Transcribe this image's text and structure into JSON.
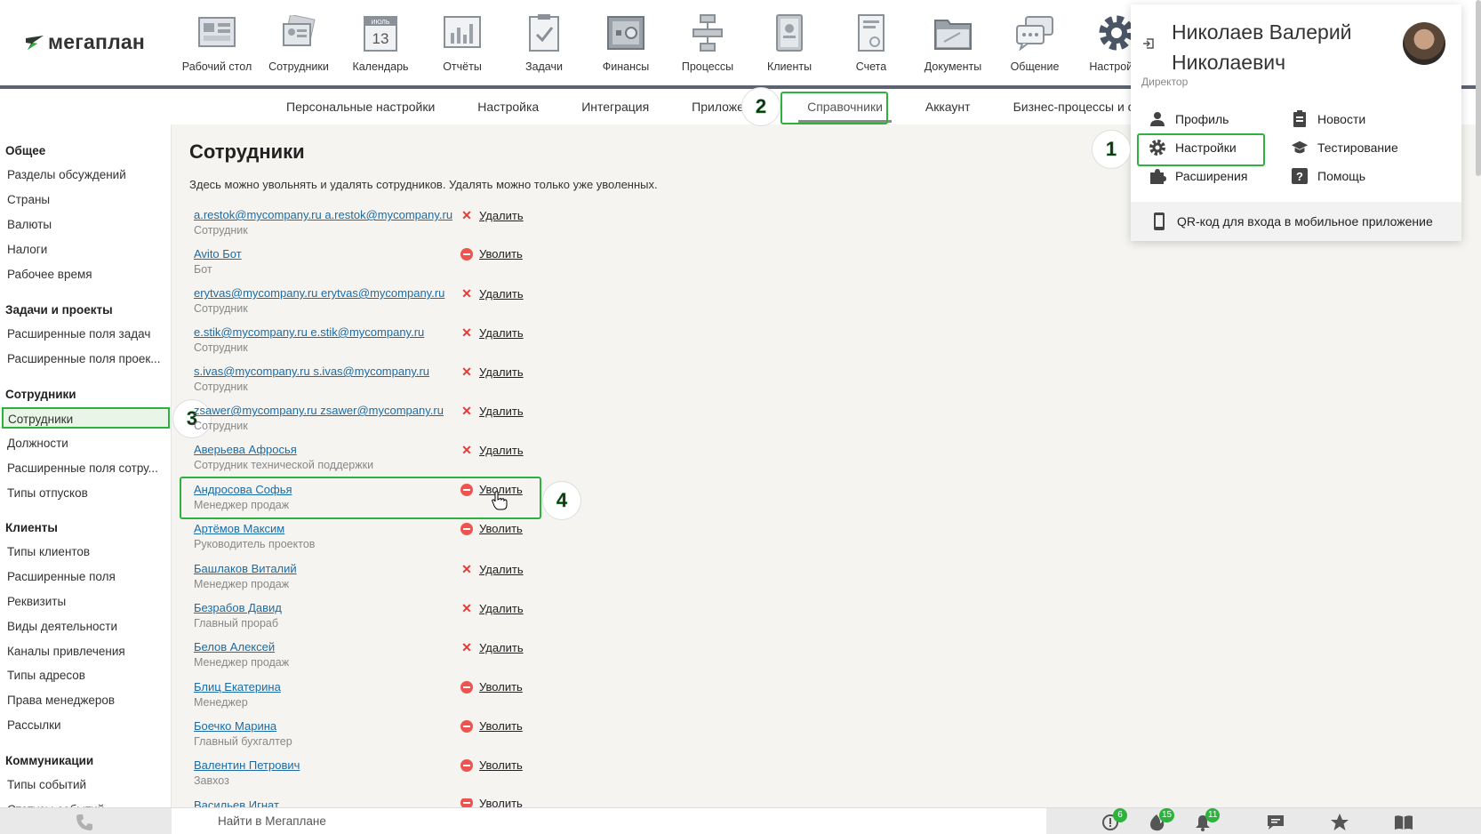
{
  "logo": "мегаплан",
  "nav": [
    {
      "label": "Рабочий стол",
      "icon": "desktop-icon"
    },
    {
      "label": "Сотрудники",
      "icon": "employees-icon"
    },
    {
      "label": "Календарь",
      "icon": "calendar-icon",
      "month": "ИЮЛЬ",
      "day": "13"
    },
    {
      "label": "Отчёты",
      "icon": "reports-icon"
    },
    {
      "label": "Задачи",
      "icon": "tasks-icon"
    },
    {
      "label": "Финансы",
      "icon": "finance-icon"
    },
    {
      "label": "Процессы",
      "icon": "processes-icon"
    },
    {
      "label": "Клиенты",
      "icon": "clients-icon"
    },
    {
      "label": "Счета",
      "icon": "invoices-icon"
    },
    {
      "label": "Документы",
      "icon": "documents-icon"
    },
    {
      "label": "Общение",
      "icon": "chat-icon"
    },
    {
      "label": "Настройки",
      "icon": "settings-icon"
    }
  ],
  "subnav": [
    {
      "label": "Персональные настройки"
    },
    {
      "label": "Настройка"
    },
    {
      "label": "Интеграция"
    },
    {
      "label": "Приложения"
    },
    {
      "label": "Справочники",
      "active": true
    },
    {
      "label": "Аккаунт"
    },
    {
      "label": "Бизнес-процессы и сделки"
    }
  ],
  "sidebar": {
    "sections": [
      {
        "title": "Общее",
        "items": [
          "Разделы обсуждений",
          "Страны",
          "Валюты",
          "Налоги",
          "Рабочее время"
        ]
      },
      {
        "title": "Задачи и проекты",
        "items": [
          "Расширенные поля задач",
          "Расширенные поля проек..."
        ]
      },
      {
        "title": "Сотрудники",
        "items": [
          "Сотрудники",
          "Должности",
          "Расширенные поля сотру...",
          "Типы отпусков"
        ]
      },
      {
        "title": "Клиенты",
        "items": [
          "Типы клиентов",
          "Расширенные поля",
          "Реквизиты",
          "Виды деятельности",
          "Каналы привлечения",
          "Типы адресов",
          "Права менеджеров",
          "Рассылки"
        ]
      },
      {
        "title": "Коммуникации",
        "items": [
          "Типы событий",
          "Статусы событий"
        ]
      }
    ]
  },
  "main": {
    "title": "Сотрудники",
    "description": "Здесь можно увольнять и удалять сотрудников. Удалять можно только уже уволенных.",
    "employees": [
      {
        "name": "a.restok@mycompany.ru a.restok@mycompany.ru",
        "role": "Сотрудник",
        "action": "Удалить",
        "type": "delete"
      },
      {
        "name": "Avito Бот",
        "role": "Бот",
        "action": "Уволить",
        "type": "fire"
      },
      {
        "name": "erytvas@mycompany.ru erytvas@mycompany.ru",
        "role": "Сотрудник",
        "action": "Удалить",
        "type": "delete"
      },
      {
        "name": "e.stik@mycompany.ru e.stik@mycompany.ru",
        "role": "Сотрудник",
        "action": "Удалить",
        "type": "delete"
      },
      {
        "name": "s.ivas@mycompany.ru s.ivas@mycompany.ru",
        "role": "Сотрудник",
        "action": "Удалить",
        "type": "delete"
      },
      {
        "name": "zsawer@mycompany.ru zsawer@mycompany.ru",
        "role": "Сотрудник",
        "action": "Удалить",
        "type": "delete"
      },
      {
        "name": "Аверьева Афросья",
        "role": "Сотрудник технической поддержки",
        "action": "Удалить",
        "type": "delete"
      },
      {
        "name": "Андросова Софья",
        "role": "Менеджер продаж",
        "action": "Уволить",
        "type": "fire"
      },
      {
        "name": "Артёмов Максим",
        "role": "Руководитель проектов",
        "action": "Уволить",
        "type": "fire"
      },
      {
        "name": "Башлаков Виталий",
        "role": "Менеджер продаж",
        "action": "Удалить",
        "type": "delete"
      },
      {
        "name": "Безрабов Давид",
        "role": "Главный прораб",
        "action": "Удалить",
        "type": "delete"
      },
      {
        "name": "Белов Алексей",
        "role": "Менеджер продаж",
        "action": "Удалить",
        "type": "delete"
      },
      {
        "name": "Блиц Екатерина",
        "role": "Менеджер",
        "action": "Уволить",
        "type": "fire"
      },
      {
        "name": "Боечко Марина",
        "role": "Главный бухгалтер",
        "action": "Уволить",
        "type": "fire"
      },
      {
        "name": "Валентин Петрович",
        "role": "Завхоз",
        "action": "Уволить",
        "type": "fire"
      },
      {
        "name": "Васильев Игнат",
        "role": "",
        "action": "Уволить",
        "type": "fire"
      }
    ]
  },
  "user_menu": {
    "name_line1": "Николаев Валерий",
    "name_line2": "Николаевич",
    "role": "Директор",
    "items": [
      {
        "label": "Профиль",
        "icon": "person-icon"
      },
      {
        "label": "Новости",
        "icon": "news-icon"
      },
      {
        "label": "Настройки",
        "icon": "gear-icon"
      },
      {
        "label": "Тестирование",
        "icon": "graduation-cap-icon"
      },
      {
        "label": "Расширения",
        "icon": "puzzle-icon"
      },
      {
        "label": "Помощь",
        "icon": "help-icon"
      }
    ],
    "qr_label": "QR-код для входа в мобильное приложение"
  },
  "annotations": [
    "1",
    "2",
    "3",
    "4"
  ],
  "bottombar": {
    "search_placeholder": "Найти в Мегаплане",
    "counts": {
      "alerts": "6",
      "hot": "15",
      "notifications": "11"
    }
  },
  "colors": {
    "accent": "#2db33d",
    "link": "#1a6ca8",
    "delete": "#e53935",
    "fire": "#ef5350"
  }
}
